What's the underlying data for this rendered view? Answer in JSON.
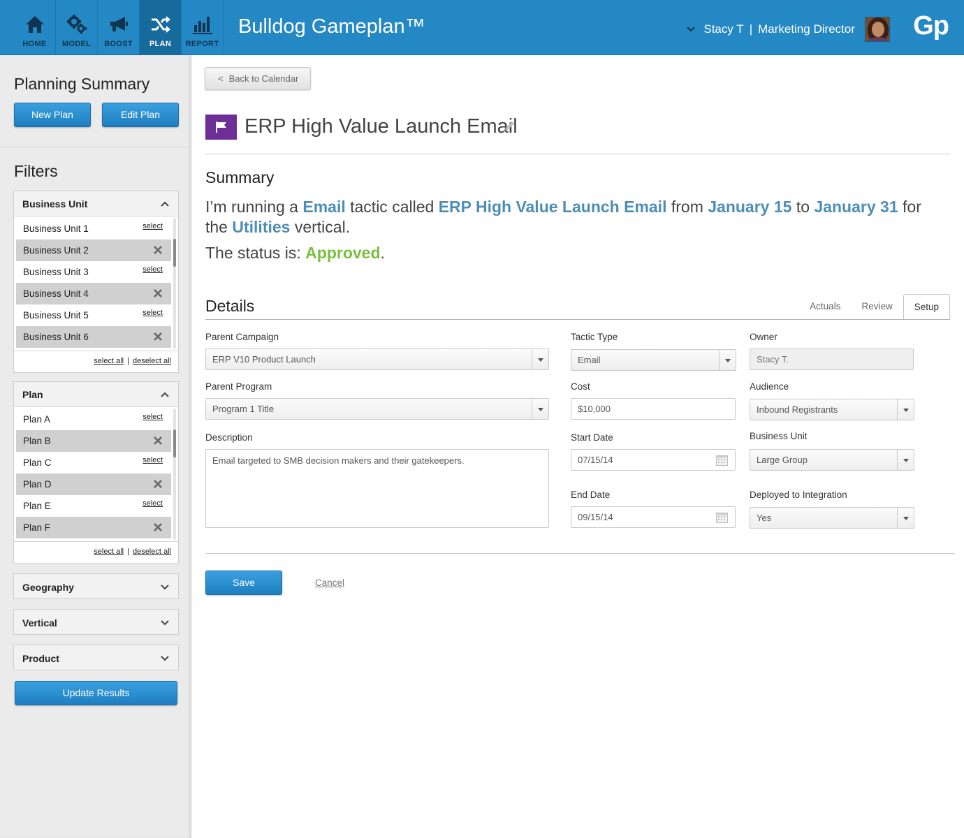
{
  "nav": {
    "items": [
      {
        "label": "HOME",
        "icon": "home-icon"
      },
      {
        "label": "MODEL",
        "icon": "gears-icon"
      },
      {
        "label": "BOOST",
        "icon": "megaphone-icon"
      },
      {
        "label": "PLAN",
        "icon": "shuffle-icon",
        "active": true
      },
      {
        "label": "REPORT",
        "icon": "bar-chart-icon"
      }
    ],
    "brand": "Bulldog Gameplan™",
    "user_name": "Stacy T",
    "separator": "|",
    "user_role": "Marketing Director",
    "logo": "Gp"
  },
  "sidebar": {
    "title": "Planning Summary",
    "new_plan": "New Plan",
    "edit_plan": "Edit Plan",
    "filters_title": "Filters",
    "business_unit": {
      "title": "Business Unit",
      "items": [
        {
          "label": "Business Unit 1",
          "selected": false,
          "action": "select"
        },
        {
          "label": "Business Unit 2",
          "selected": true,
          "action": ""
        },
        {
          "label": "Business Unit 3",
          "selected": false,
          "action": "select"
        },
        {
          "label": "Business Unit 4",
          "selected": true,
          "action": ""
        },
        {
          "label": "Business Unit 5",
          "selected": false,
          "action": "select"
        },
        {
          "label": "Business Unit 6",
          "selected": true,
          "action": ""
        }
      ],
      "select_all": "select all",
      "deselect_all": "deselect all"
    },
    "plan": {
      "title": "Plan",
      "items": [
        {
          "label": "Plan A",
          "selected": false,
          "action": "select"
        },
        {
          "label": "Plan B",
          "selected": true,
          "action": ""
        },
        {
          "label": "Plan C",
          "selected": false,
          "action": "select"
        },
        {
          "label": "Plan D",
          "selected": true,
          "action": ""
        },
        {
          "label": "Plan E",
          "selected": false,
          "action": "select"
        },
        {
          "label": "Plan F",
          "selected": true,
          "action": ""
        }
      ],
      "select_all": "select all",
      "deselect_all": "deselect all"
    },
    "geography": "Geography",
    "vertical": "Vertical",
    "product": "Product",
    "update_results": "Update Results",
    "pipe": "|"
  },
  "main": {
    "back_label": "Back to Calendar",
    "back_arrow": "<",
    "title": "ERP High Value Launch Email",
    "summary_heading": "Summary",
    "summary": {
      "p1": "I’m running a ",
      "tactic": "Email",
      "p2": " tactic called ",
      "name": "ERP High Value Launch Email",
      "p3": " from ",
      "start": "January 15",
      "p4": " to ",
      "end": "January 31",
      "p5": " for the ",
      "vertical": "Utilities",
      "p6": " vertical.",
      "status_prefix": "The status is: ",
      "status": "Approved",
      "status_suffix": "."
    },
    "details_heading": "Details",
    "tabs": [
      "Actuals",
      "Review",
      "Setup"
    ],
    "active_tab": "Setup",
    "fields": {
      "parent_campaign_label": "Parent Campaign",
      "parent_campaign": "ERP V10 Product Launch",
      "parent_program_label": "Parent Program",
      "parent_program": "Program 1 Title",
      "description_label": "Description",
      "description": "Email targeted to SMB decision makers and their gatekeepers.",
      "tactic_type_label": "Tactic Type",
      "tactic_type": "Email",
      "cost_label": "Cost",
      "cost": "$10,000",
      "start_date_label": "Start Date",
      "start_date": "07/15/14",
      "end_date_label": "End Date",
      "end_date": "09/15/14",
      "owner_label": "Owner",
      "owner": "Stacy T.",
      "audience_label": "Audience",
      "audience": "Inbound Registrants",
      "business_unit_label": "Business Unit",
      "business_unit": "Large Group",
      "deployed_label": "Deployed to Integration",
      "deployed": "Yes"
    },
    "save": "Save",
    "cancel": "Cancel"
  },
  "colors": {
    "topbar": "#2488c4",
    "accent_blue": "#4d8db8",
    "status_green": "#7bbe3f",
    "flag_purple": "#6b2f95"
  }
}
